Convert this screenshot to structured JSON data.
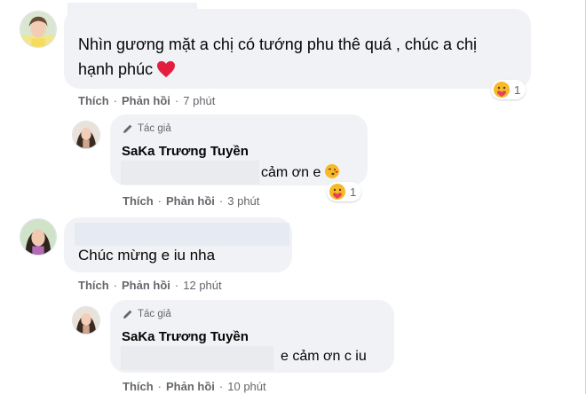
{
  "colors": {
    "bubble": "#f0f2f5",
    "secondary_text": "#65676b",
    "primary_text": "#050505",
    "heart": "#e41e3f",
    "haha_yellow": "#f7b928"
  },
  "comments": [
    {
      "text_line1": "Nhìn gương mặt a chị có tướng phu thê quá , chúc a chị",
      "text_line2": "hạnh phúc",
      "reaction_count": "1",
      "like_label": "Thích",
      "reply_label": "Phản hồi",
      "time": "7 phút",
      "reply": {
        "author_tag": "Tác giả",
        "author_name": "SaKa Trương Tuyền",
        "text": "cảm ơn e",
        "reaction_count": "1",
        "like_label": "Thích",
        "reply_label": "Phản hồi",
        "time": "3 phút"
      }
    },
    {
      "text": "Chúc mừng e iu nha",
      "like_label": "Thích",
      "reply_label": "Phản hồi",
      "time": "12 phút",
      "reply": {
        "author_tag": "Tác giả",
        "author_name": "SaKa Trương Tuyền",
        "text": "e cảm ơn c iu",
        "like_label": "Thích",
        "reply_label": "Phản hồi",
        "time": "10 phút"
      }
    }
  ]
}
